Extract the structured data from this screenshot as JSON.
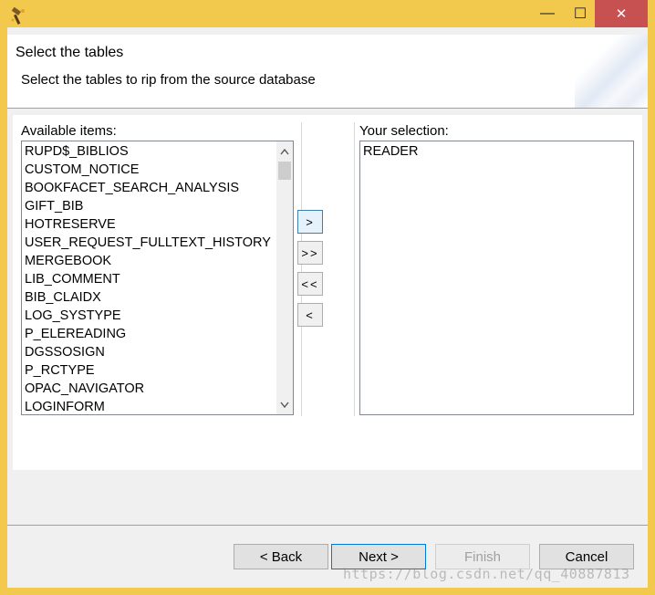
{
  "window": {
    "app_icon": "wand-icon",
    "minimize_glyph": "—",
    "maximize_glyph": "☐",
    "close_glyph": "✕"
  },
  "header": {
    "title": "Select the tables",
    "description": "Select the tables to rip from the source database"
  },
  "available": {
    "label": "Available items:",
    "items": [
      "RUPD$_BIBLIOS",
      "CUSTOM_NOTICE",
      "BOOKFACET_SEARCH_ANALYSIS",
      "GIFT_BIB",
      "HOTRESERVE",
      "USER_REQUEST_FULLTEXT_HISTORY",
      "MERGEBOOK",
      "LIB_COMMENT",
      "BIB_CLAIDX",
      "LOG_SYSTYPE",
      "P_ELEREADING",
      "DGSSOSIGN",
      "P_RCTYPE",
      "OPAC_NAVIGATOR",
      "LOGINFORM"
    ],
    "scroll_up_glyph": "⌃",
    "scroll_down_glyph": "⌄"
  },
  "selection": {
    "label": "Your selection:",
    "items": [
      "READER"
    ]
  },
  "move_buttons": {
    "add": ">",
    "add_all": ">>",
    "remove_all": "<<",
    "remove": "<"
  },
  "footer": {
    "back": "< Back",
    "next": "Next >",
    "finish": "Finish",
    "cancel": "Cancel"
  },
  "watermark": "https://blog.csdn.net/qq_40887813",
  "colors": {
    "titlebar": "#f2c94c",
    "close_button": "#c75050",
    "default_button_border": "#0078d7"
  }
}
